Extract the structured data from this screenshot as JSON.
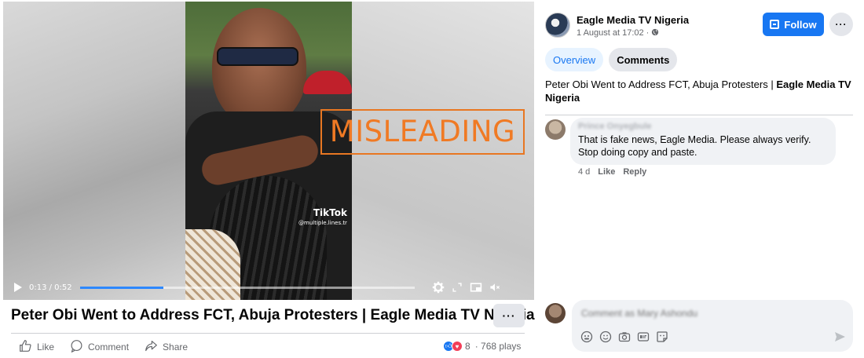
{
  "video": {
    "overlay_label": "MISLEADING",
    "watermark_logo": "TikTok",
    "watermark_handle": "@multiple.lines.tr",
    "time": "0:13 / 0:52",
    "progress_fraction": 0.25
  },
  "post": {
    "title": "Peter Obi Went to Address FCT, Abuja Protesters | Eagle Media TV Nigeria",
    "more_label": "···",
    "actions": {
      "like": "Like",
      "comment": "Comment",
      "share": "Share"
    },
    "reaction_count": "8",
    "plays": "· 768 plays"
  },
  "sidebar": {
    "page_name": "Eagle Media TV Nigeria",
    "post_meta": "1 August at 17:02 · ",
    "follow_label": "Follow",
    "more_label": "···",
    "tabs": [
      {
        "label": "Overview"
      },
      {
        "label": "Comments"
      }
    ],
    "caption_plain": "Peter Obi Went to Address FCT, Abuja Protesters | ",
    "caption_bold": "Eagle Media TV Nigeria",
    "comment": {
      "author": "Prince Onyegbule",
      "text": "That is fake news, Eagle Media. Please always verify. Stop doing copy and paste.",
      "age": "4 d",
      "like_label": "Like",
      "reply_label": "Reply"
    },
    "composer_placeholder": "Comment as Mary Ashondu"
  },
  "colors": {
    "brand_blue": "#1877f2",
    "misleading_orange": "#f07a24",
    "love_red": "#f33e58"
  }
}
